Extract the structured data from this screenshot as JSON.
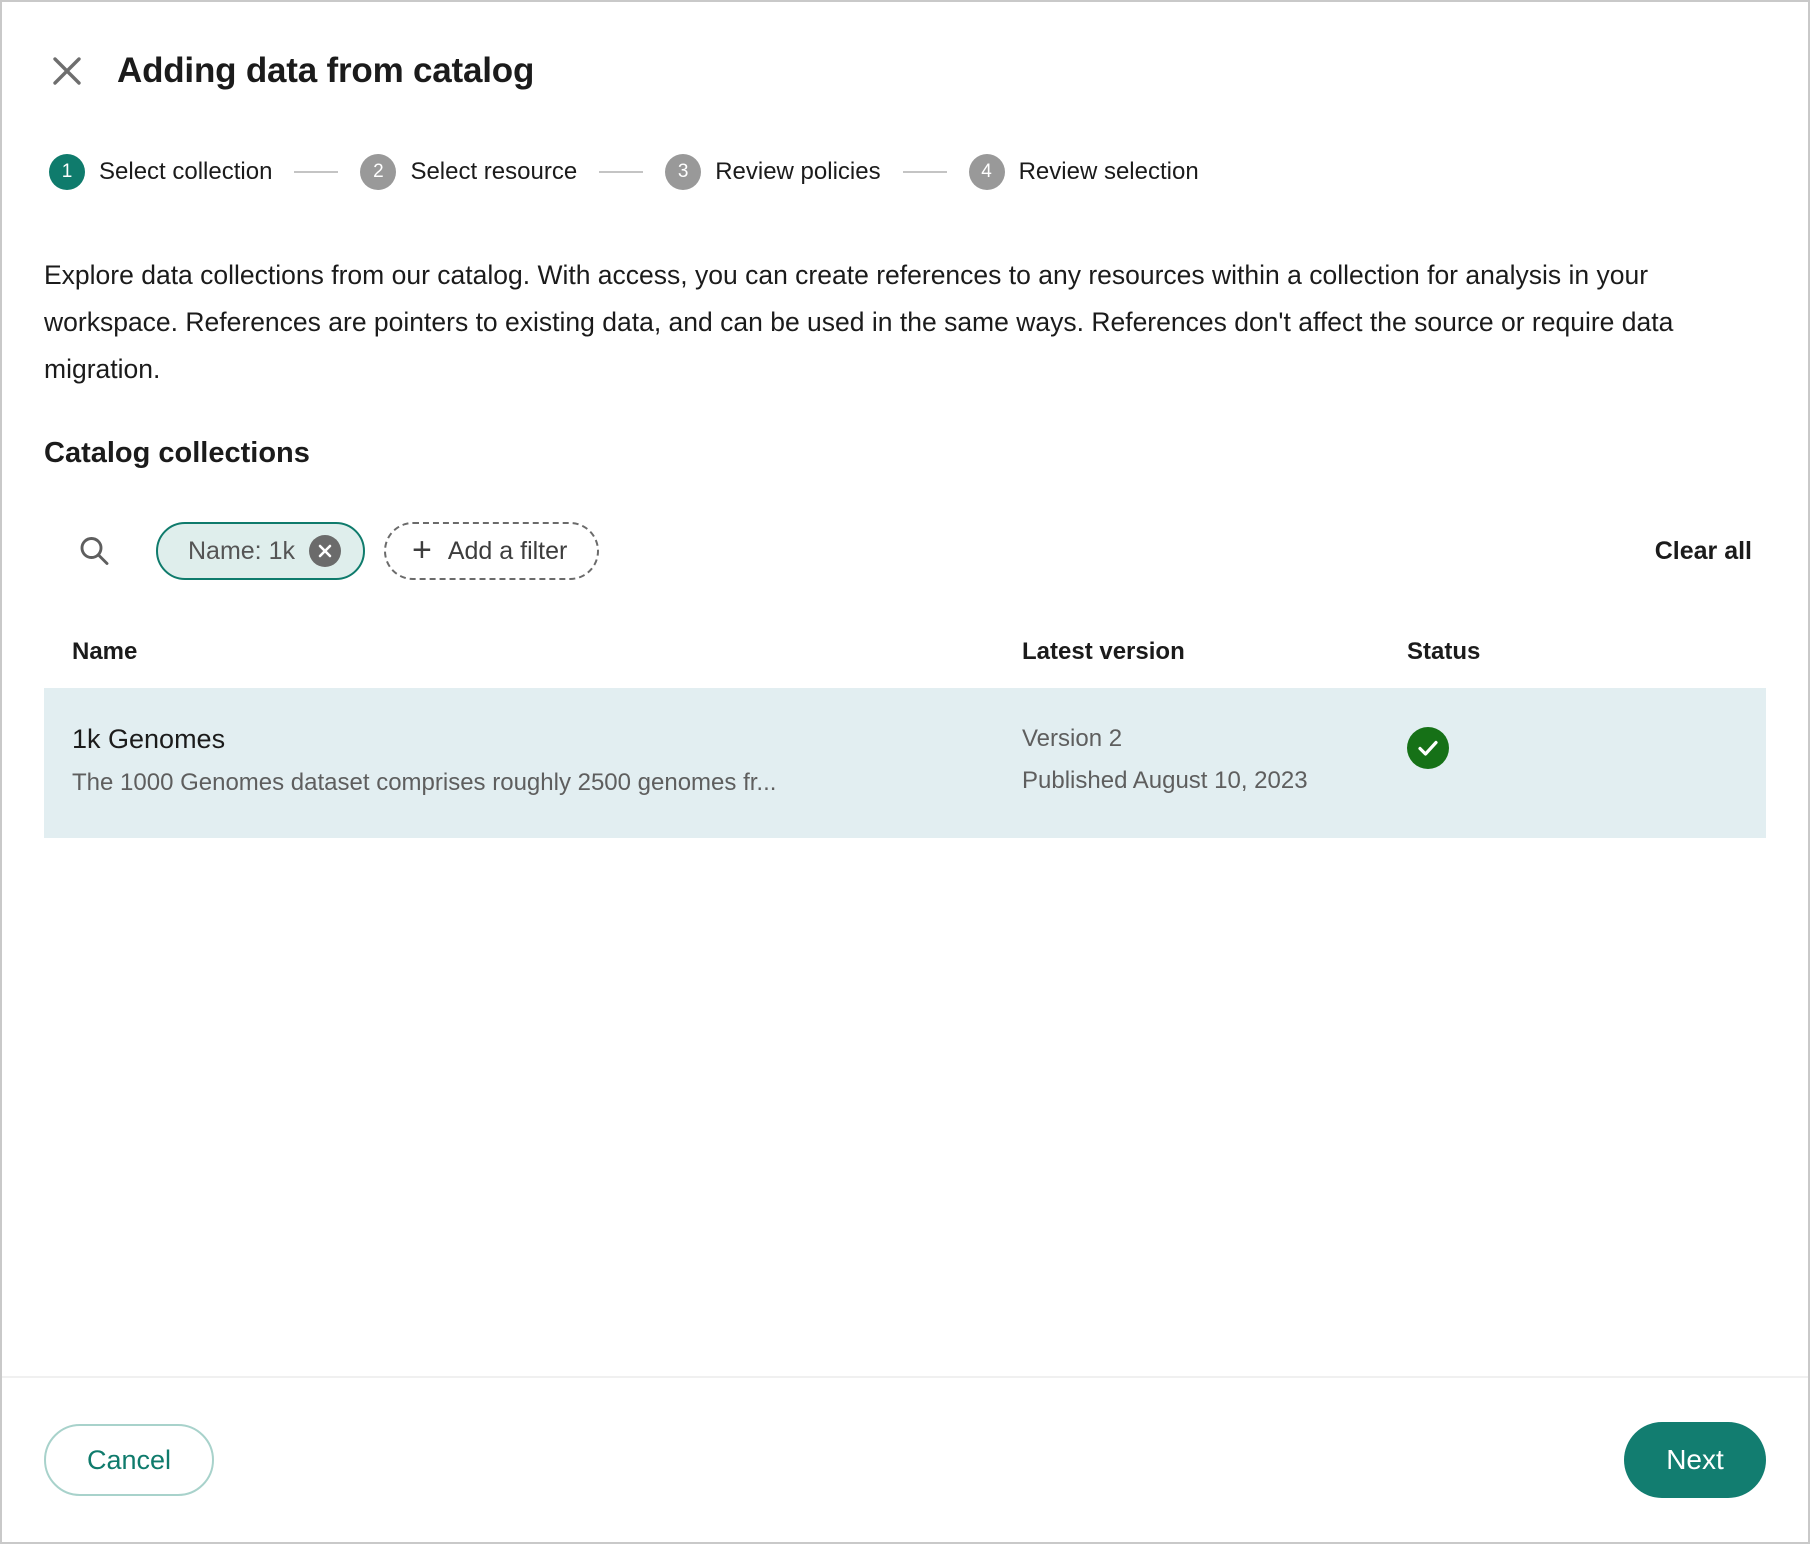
{
  "dialog": {
    "title": "Adding data from catalog",
    "close_icon": "close-icon"
  },
  "stepper": {
    "steps": [
      {
        "number": "1",
        "label": "Select collection",
        "state": "active"
      },
      {
        "number": "2",
        "label": "Select resource",
        "state": "inactive"
      },
      {
        "number": "3",
        "label": "Review policies",
        "state": "inactive"
      },
      {
        "number": "4",
        "label": "Review selection",
        "state": "inactive"
      }
    ]
  },
  "content": {
    "intro": "Explore data collections from our catalog. With access, you can create references to any resources within a collection for analysis in your workspace. References are pointers to existing data, and can be used in the same ways. References don't affect the source or require data migration.",
    "section_title": "Catalog collections"
  },
  "filters": {
    "search_icon": "search-icon",
    "chip": {
      "label": "Name: 1k",
      "remove_icon": "close-circle-icon"
    },
    "add_filter": {
      "plus": "+",
      "label": "Add a filter"
    },
    "clear_all": "Clear all"
  },
  "table": {
    "columns": [
      "Name",
      "Latest version",
      "Status"
    ],
    "rows": [
      {
        "name": "1k Genomes",
        "description": "The 1000 Genomes dataset comprises roughly 2500 genomes fr...",
        "version": "Version 2",
        "published": "Published August 10, 2023",
        "status_icon": "check-circle-icon",
        "selected": true
      }
    ]
  },
  "footer": {
    "cancel_label": "Cancel",
    "next_label": "Next"
  },
  "colors": {
    "accent_teal": "#127d70",
    "step_active": "#0f7b6c",
    "step_inactive": "#999999",
    "row_selected_bg": "#e2eef1",
    "chip_bg": "#dfeeec",
    "status_green": "#167117"
  }
}
